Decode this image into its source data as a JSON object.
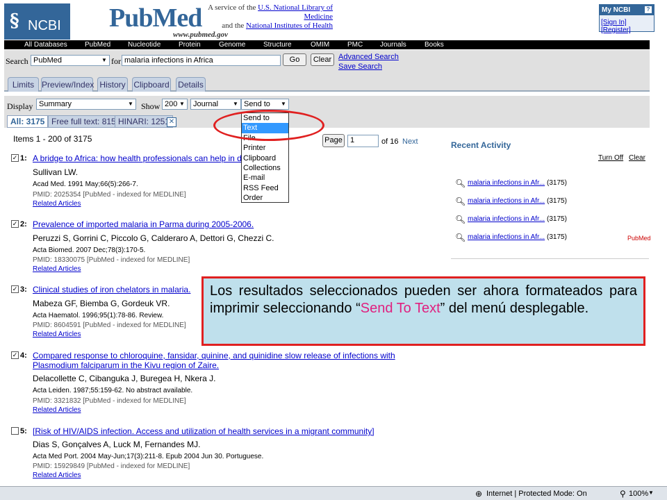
{
  "header": {
    "ncbi_text": "NCBI",
    "pubmed_logo": "PubMed",
    "pubmed_url": "www.pubmed.gov",
    "service_line1": "A service of the ",
    "service_link1": "U.S. National Library of Medicine",
    "service_line2": "and the ",
    "service_link2": "National Institutes of Health",
    "myncbi_title": "My NCBI",
    "myncbi_help": "?",
    "sign_in": "[Sign In]",
    "register": "[Register]"
  },
  "nav": [
    "All Databases",
    "PubMed",
    "Nucleotide",
    "Protein",
    "Genome",
    "Structure",
    "OMIM",
    "PMC",
    "Journals",
    "Books"
  ],
  "search": {
    "label": "Search",
    "db_value": "PubMed",
    "for_label": "for",
    "query": "malaria infections in Africa",
    "go": "Go",
    "clear": "Clear",
    "advanced": "Advanced Search",
    "save": "Save Search"
  },
  "tabs": [
    "Limits",
    "Preview/Index",
    "History",
    "Clipboard",
    "Details"
  ],
  "display": {
    "display_label": "Display",
    "display_value": "Summary",
    "show_label": "Show",
    "show_value": "200",
    "sort_value": "Journal",
    "send_to_value": "Send to"
  },
  "filters": [
    "All: 3175",
    "Free full text: 815",
    "HINARI: 1251"
  ],
  "dropdown_options": [
    "Send to",
    "Text",
    "File",
    "Printer",
    "Clipboard",
    "Collections",
    "E-mail",
    "RSS Feed",
    "Order"
  ],
  "dropdown_highlight": "Text",
  "items_count": "Items 1 - 200 of 3175",
  "pager": {
    "page_btn": "Page",
    "page_value": "1",
    "of": "of 16",
    "next": "Next"
  },
  "results": [
    {
      "num": "1:",
      "checked": true,
      "title": "A bridge to Africa: how health professionals can help in develop",
      "authors": "Sullivan LW.",
      "source": "Acad Med. 1991 May;66(5):266-7.",
      "pmid": "PMID: 2025354 [PubMed - indexed for MEDLINE]",
      "related": "Related Articles"
    },
    {
      "num": "2:",
      "checked": true,
      "title": "Prevalence of imported malaria in Parma during 2005-2006.",
      "authors": "Peruzzi S, Gorrini C, Piccolo G, Calderaro A, Dettori G, Chezzi C.",
      "source": "Acta Biomed. 2007 Dec;78(3):170-5.",
      "pmid": "PMID: 18330075 [PubMed - indexed for MEDLINE]",
      "related": "Related Articles"
    },
    {
      "num": "3:",
      "checked": true,
      "title": "Clinical studies of iron chelators in malaria.",
      "authors": "Mabeza GF, Biemba G, Gordeuk VR.",
      "source": "Acta Haematol. 1996;95(1):78-86. Review.",
      "pmid": "PMID: 8604591 [PubMed - indexed for MEDLINE]",
      "related": "Related Articles"
    },
    {
      "num": "4:",
      "checked": true,
      "title": "Compared response to chloroquine, fansidar, quinine, and quinidine slow release of infections with Plasmodium falciparum in the Kivu region of Zaire.",
      "authors": "Delacollette C, Cibanguka J, Buregea H, Nkera J.",
      "source": "Acta Leiden. 1987;55:159-62. No abstract available.",
      "pmid": "PMID: 3321832 [PubMed - indexed for MEDLINE]",
      "related": "Related Articles"
    },
    {
      "num": "5:",
      "checked": false,
      "title": "[Risk of HIV/AIDS infection. Access and utilization of health services in a migrant community]",
      "authors": "Dias S, Gonçalves A, Luck M, Fernandes MJ.",
      "source": "Acta Med Port. 2004 May-Jun;17(3):211-8. Epub 2004 Jun 30. Portuguese.",
      "pmid": "PMID: 15929849 [PubMed - indexed for MEDLINE]",
      "related": "Related Articles"
    }
  ],
  "recent": {
    "title": "Recent Activity",
    "turn_off": "Turn Off",
    "clear": "Clear",
    "items": [
      {
        "link": "malaria infections in Afr...",
        "count": "(3175)"
      },
      {
        "link": "malaria infections in Afr...",
        "count": "(3175)"
      },
      {
        "link": "malaria infections in Afr...",
        "count": "(3175)"
      },
      {
        "link": "malaria infections in Afr...",
        "count": "(3175)"
      }
    ],
    "pubmed_tag": "PubMed"
  },
  "callout": {
    "part1": "Los resultados seleccionados pueden ser ahora formateados para imprimir seleccionando “",
    "highlight": "Send To Text",
    "part2": "” del menú desplegable."
  },
  "status": {
    "zone": "Internet | Protected Mode: On",
    "zoom": "100%"
  },
  "colors": {
    "ncbi_blue": "#336699",
    "callout_bg": "#bfe0ec",
    "annotation_red": "#e02020",
    "highlight_pink": "#e0207f"
  }
}
